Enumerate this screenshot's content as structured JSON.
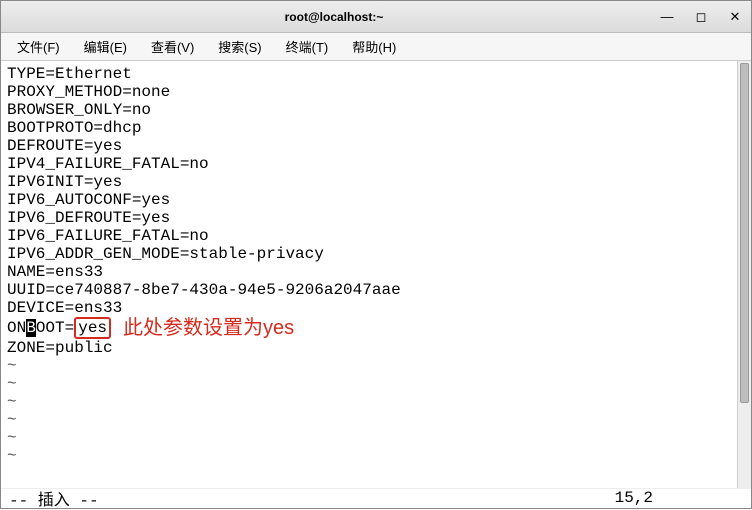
{
  "window": {
    "title": "root@localhost:~"
  },
  "menu": {
    "file": "文件(F)",
    "edit": "编辑(E)",
    "view": "查看(V)",
    "search": "搜索(S)",
    "terminal": "终端(T)",
    "help": "帮助(H)"
  },
  "config": {
    "lines": [
      "TYPE=Ethernet",
      "PROXY_METHOD=none",
      "BROWSER_ONLY=no",
      "BOOTPROTO=dhcp",
      "DEFROUTE=yes",
      "IPV4_FAILURE_FATAL=no",
      "IPV6INIT=yes",
      "IPV6_AUTOCONF=yes",
      "IPV6_DEFROUTE=yes",
      "IPV6_FAILURE_FATAL=no",
      "IPV6_ADDR_GEN_MODE=stable-privacy",
      "NAME=ens33",
      "UUID=ce740887-8be7-430a-94e5-9206a2047aae",
      "DEVICE=ens33"
    ],
    "onboot_prefix": "ON",
    "onboot_cursor": "B",
    "onboot_after": "OOT=",
    "onboot_boxed": "yes",
    "zone_line": "ZONE=public",
    "tilde": "~"
  },
  "annotation": {
    "text": "此处参数设置为yes",
    "color": "#d52b1e"
  },
  "status": {
    "mode": "-- 插入 --",
    "position": "15,2"
  },
  "icons": {
    "minimize": "—",
    "maximize": "◻",
    "close": "✕"
  }
}
